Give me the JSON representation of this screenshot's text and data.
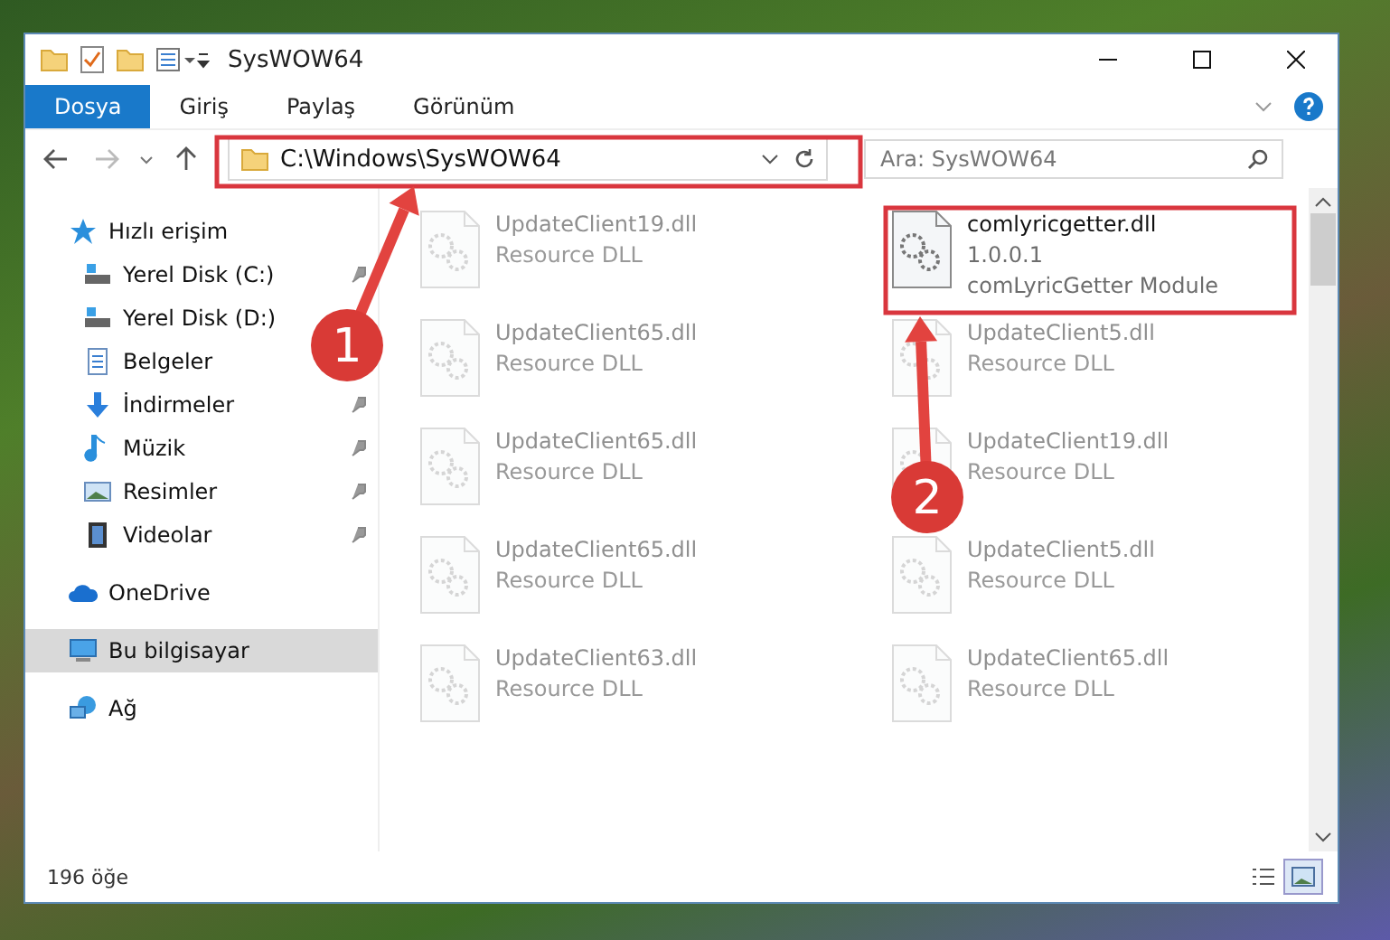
{
  "window": {
    "title": "SysWOW64"
  },
  "ribbon": {
    "tabs": [
      {
        "label": "Dosya",
        "selected": true
      },
      {
        "label": "Giriş",
        "selected": false
      },
      {
        "label": "Paylaş",
        "selected": false
      },
      {
        "label": "Görünüm",
        "selected": false
      }
    ]
  },
  "address_bar": {
    "path": "C:\\Windows\\SysWOW64"
  },
  "search": {
    "placeholder": "Ara: SysWOW64"
  },
  "sidebar": {
    "items": [
      {
        "label": "Hızlı erişim",
        "kind": "star",
        "pinned": false,
        "selected": false,
        "children": [
          {
            "label": "Yerel Disk (C:)",
            "kind": "drive",
            "pinned": true,
            "selected": false
          },
          {
            "label": "Yerel Disk (D:)",
            "kind": "drive",
            "selected": false
          },
          {
            "label": "Belgeler",
            "kind": "document",
            "selected": false
          },
          {
            "label": "İndirmeler",
            "kind": "download",
            "pinned": true,
            "selected": false
          },
          {
            "label": "Müzik",
            "kind": "music",
            "pinned": true,
            "selected": false
          },
          {
            "label": "Resimler",
            "kind": "picture",
            "pinned": true,
            "selected": false
          },
          {
            "label": "Videolar",
            "kind": "video",
            "pinned": true,
            "selected": false
          }
        ]
      },
      {
        "label": "OneDrive",
        "kind": "cloud",
        "pinned": false,
        "selected": false
      },
      {
        "label": "Bu bilgisayar",
        "kind": "computer",
        "pinned": false,
        "selected": true
      },
      {
        "label": "Ağ",
        "kind": "network",
        "pinned": false,
        "selected": false
      }
    ]
  },
  "files": [
    {
      "name": "UpdateClient19.dll",
      "details": [
        "Resource DLL"
      ],
      "faded": true
    },
    {
      "name": "comlyricgetter.dll",
      "details": [
        "1.0.0.1",
        "comLyricGetter Module"
      ],
      "faded": false
    },
    {
      "name": "UpdateClient65.dll",
      "details": [
        "Resource DLL"
      ],
      "faded": true
    },
    {
      "name": "UpdateClient5.dll",
      "details": [
        "Resource DLL"
      ],
      "faded": true
    },
    {
      "name": "UpdateClient65.dll",
      "details": [
        "Resource DLL"
      ],
      "faded": true
    },
    {
      "name": "UpdateClient19.dll",
      "details": [
        "Resource DLL"
      ],
      "faded": true
    },
    {
      "name": "UpdateClient65.dll",
      "details": [
        "Resource DLL"
      ],
      "faded": true
    },
    {
      "name": "UpdateClient5.dll",
      "details": [
        "Resource DLL"
      ],
      "faded": true
    },
    {
      "name": "UpdateClient63.dll",
      "details": [
        "Resource DLL"
      ],
      "faded": true
    },
    {
      "name": "UpdateClient65.dll",
      "details": [
        "Resource DLL"
      ],
      "faded": true
    }
  ],
  "status_bar": {
    "count": "196 öğe",
    "views": [
      {
        "kind": "details",
        "selected": false
      },
      {
        "kind": "large-icons",
        "selected": true
      }
    ]
  },
  "annotations": [
    {
      "label": "1",
      "kind": "address-bar"
    },
    {
      "label": "2",
      "kind": "selected-file"
    }
  ]
}
